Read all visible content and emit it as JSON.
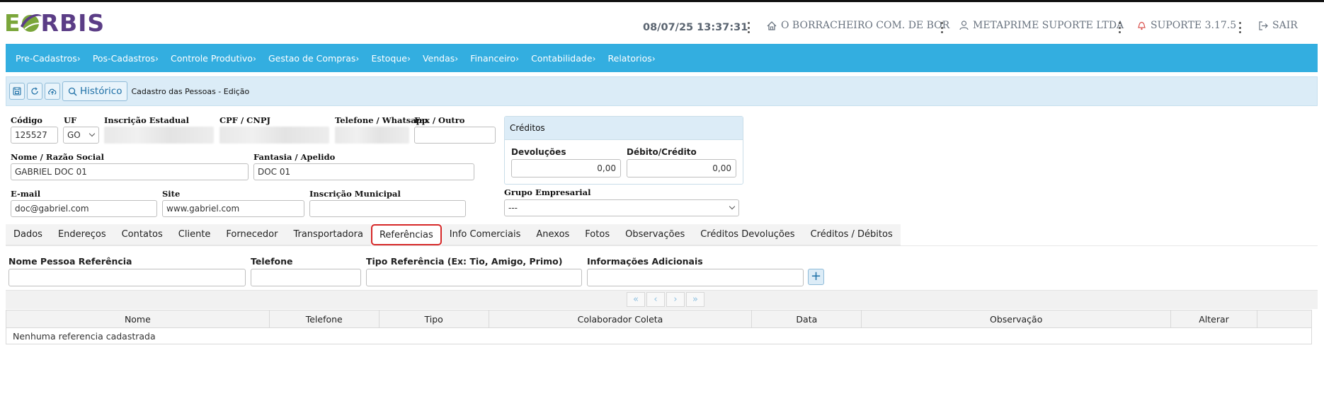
{
  "header": {
    "logo_e": "E",
    "logo_rest": "RBIS",
    "datetime": "08/07/25 13:37:31",
    "company": "O BORRACHEIRO COM. DE BOR",
    "user": "METAPRIME SUPORTE LTDA",
    "support": "SUPORTE 3.17.5",
    "logout": "SAIR"
  },
  "menu": [
    "Pre-Cadastros›",
    "Pos-Cadastros›",
    "Controle Produtivo›",
    "Gestao de Compras›",
    "Estoque›",
    "Vendas›",
    "Financeiro›",
    "Contabilidade›",
    "Relatorios›"
  ],
  "toolbar": {
    "historico": "Histórico",
    "title": "Cadastro das Pessoas - Edição"
  },
  "form": {
    "codigo_label": "Código",
    "codigo_value": "125527",
    "uf_label": "UF",
    "uf_value": "GO",
    "ie_label": "Inscrição Estadual",
    "cpf_label": "CPF / CNPJ",
    "telefone_label": "Telefone / Whatsapp",
    "fax_label": "Fax / Outro",
    "nome_label": "Nome / Razão Social",
    "nome_value": "GABRIEL DOC 01",
    "fantasia_label": "Fantasia / Apelido",
    "fantasia_value": "DOC 01",
    "email_label": "E-mail",
    "email_value": "doc@gabriel.com",
    "site_label": "Site",
    "site_value": "www.gabriel.com",
    "im_label": "Inscrição Municipal",
    "grupo_label": "Grupo Empresarial",
    "grupo_value": "---"
  },
  "credits": {
    "title": "Créditos",
    "devolucoes_label": "Devoluções",
    "devolucoes_value": "0,00",
    "debito_label": "Débito/Crédito",
    "debito_value": "0,00"
  },
  "tabs": [
    "Dados",
    "Endereços",
    "Contatos",
    "Cliente",
    "Fornecedor",
    "Transportadora",
    "Referências",
    "Info Comerciais",
    "Anexos",
    "Fotos",
    "Observações",
    "Créditos Devoluções",
    "Créditos / Débitos"
  ],
  "active_tab": "Referências",
  "references": {
    "nome_label": "Nome Pessoa Referência",
    "telefone_label": "Telefone",
    "tipo_label": "Tipo Referência (Ex: Tio, Amigo, Primo)",
    "info_label": "Informações Adicionais",
    "add_button": "+"
  },
  "pager": [
    "«",
    "‹",
    "›",
    "»"
  ],
  "table": {
    "columns": [
      "Nome",
      "Telefone",
      "Tipo",
      "Colaborador Coleta",
      "Data",
      "Observação",
      "Alterar",
      ""
    ],
    "empty_message": "Nenhuma referencia cadastrada"
  },
  "colors": {
    "menubar": "#33aee0",
    "toolbar": "#dbecf7",
    "logo_green": "#7aa63a",
    "logo_purple": "#5b3d86",
    "active_tab_border": "#d62828"
  }
}
